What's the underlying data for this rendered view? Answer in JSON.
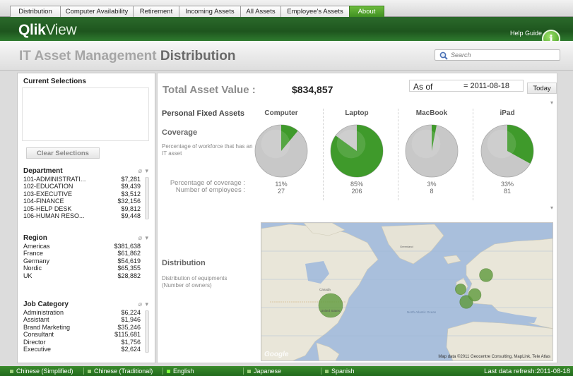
{
  "tabs": [
    "Distribution",
    "Computer Availability",
    "Retirement",
    "Incoming Assets",
    "All Assets",
    "Employee's Assets",
    "About"
  ],
  "header": {
    "logo_main": "Qlik",
    "logo_suffix": "View",
    "help_label": "Help Guide",
    "help_icon": "info-icon",
    "help_glyph": "i"
  },
  "title": {
    "part1": "IT Asset Management ",
    "part2": "Distribution"
  },
  "search": {
    "placeholder": "Search",
    "icon": "search-icon"
  },
  "sidebar": {
    "current_selections_title": "Current Selections",
    "clear_selections_label": "Clear Selections",
    "listboxes": [
      {
        "title": "Department",
        "rows": [
          {
            "name": "101-ADMINISTRATI...",
            "value": "$7,281"
          },
          {
            "name": "102-EDUCATION",
            "value": "$9,439"
          },
          {
            "name": "103-EXECUTIVE",
            "value": "$3,512"
          },
          {
            "name": "104-FINANCE",
            "value": "$32,156"
          },
          {
            "name": "105-HELP DESK",
            "value": "$9,812"
          },
          {
            "name": "106-HUMAN RESO...",
            "value": "$9,448"
          }
        ]
      },
      {
        "title": "Region",
        "rows": [
          {
            "name": "Americas",
            "value": "$381,638"
          },
          {
            "name": "France",
            "value": "$61,862"
          },
          {
            "name": "Germany",
            "value": "$54,619"
          },
          {
            "name": "Nordic",
            "value": "$65,355"
          },
          {
            "name": "UK",
            "value": "$28,882"
          }
        ]
      },
      {
        "title": "Job Category",
        "rows": [
          {
            "name": "Administration",
            "value": "$6,224"
          },
          {
            "name": "Assistant",
            "value": "$1,946"
          },
          {
            "name": "Brand Marketing",
            "value": "$35,246"
          },
          {
            "name": "Consultant",
            "value": "$115,681"
          },
          {
            "name": "Director",
            "value": "$1,756"
          },
          {
            "name": "Executive",
            "value": "$2,624"
          }
        ]
      }
    ]
  },
  "main": {
    "total_asset_label": "Total Asset Value :",
    "total_asset_value": "$834,857",
    "as_of_label": "As of",
    "as_of_value": "= 2011-08-18",
    "today_label": "Today",
    "personal_fixed_assets": "Personal Fixed Assets",
    "coverage_title": "Coverage",
    "coverage_desc": "Percentage of workforce that has an IT asset",
    "pct_label": "Percentage of coverage :",
    "emp_label": "Number of employees :",
    "distribution_title": "Distribution",
    "distribution_desc": "Distribution of equipments (Number of owners)"
  },
  "chart_data": {
    "type": "pie",
    "categories": [
      "Computer",
      "Laptop",
      "MacBook",
      "iPad"
    ],
    "coverage_text": [
      "11%",
      "85%",
      "3%",
      "33%"
    ],
    "coverage": [
      11,
      85,
      3,
      33
    ],
    "employees": [
      "27",
      "206",
      "8",
      "81"
    ],
    "colors": {
      "covered": "#3f9a2b",
      "uncovered": "#c8c8c8"
    }
  },
  "map": {
    "labels": {
      "greenland": "Greenland",
      "canada": "Canada",
      "united_states": "United States",
      "north_atlantic": "North Atlantic Ocean"
    },
    "google_label": "Google",
    "attribution": "Map data ©2011 Geocentre Consulting, MapLink, Tele Atlas",
    "bubbles": [
      {
        "name": "Americas",
        "value": 381638
      },
      {
        "name": "Nordic",
        "value": 65355
      },
      {
        "name": "France",
        "value": 61862
      },
      {
        "name": "Germany",
        "value": 54619
      },
      {
        "name": "UK",
        "value": 28882
      }
    ]
  },
  "statusbar": {
    "languages": [
      "Chinese (Simplified)",
      "Chinese (Traditional)",
      "English",
      "Japanese",
      "Spanish"
    ],
    "active_language": "English",
    "last_refresh": "Last data refresh:2011-08-18"
  }
}
